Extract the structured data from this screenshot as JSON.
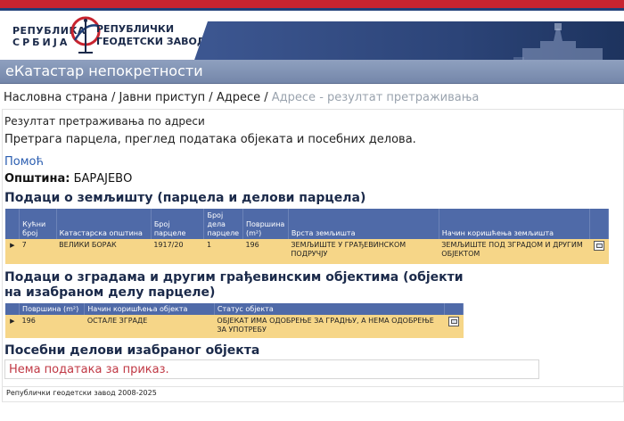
{
  "logo": {
    "left_line1": "РЕПУБЛИКА",
    "left_line2": "СРБИЈА",
    "right_line1": "РЕПУБЛИЧКИ",
    "right_line2": "ГЕОДЕТСКИ ЗАВОД"
  },
  "app_title": "еКатастар непокретности",
  "breadcrumb": {
    "items": [
      "Насловна страна",
      "Јавни приступ",
      "Адресе"
    ],
    "separator": "/",
    "current": "Адресе - резултат претраживања"
  },
  "page": {
    "result_title": "Резултат претраживања по адреси",
    "description": "Претрага парцела, преглед података објеката и посебних делова.",
    "help_link": "Помоћ",
    "municipality_label": "Општина:",
    "municipality_value": "БАРАЈЕВО"
  },
  "land": {
    "heading": "Подаци о земљишту (парцела и делови парцела)",
    "columns": [
      "Кућни број",
      "Катастарска општина",
      "Број парцеле",
      "Број дела парцеле",
      "Површина (m²)",
      "Врста земљишта",
      "Начин коришћења земљишта"
    ],
    "rows": [
      [
        "7",
        "ВЕЛИКИ БОРАК",
        "1917/20",
        "1",
        "196",
        "ЗЕМЉИШТЕ У ГРАЂЕВИНСКОМ ПОДРУЧЈУ",
        "ЗЕМЉИШТЕ ПОД ЗГРАДОМ И ДРУГИМ ОБЈЕКТОМ"
      ]
    ]
  },
  "buildings": {
    "heading_line1": "Подаци о зградама и другим грађевинским објектима (објекти",
    "heading_line2": "на изабраном делу парцеле)",
    "columns": [
      "Површина (m²)",
      "Начин коришћења објекта",
      "Статус објекта"
    ],
    "rows": [
      [
        "196",
        "ОСТАЛЕ ЗГРАДЕ",
        "ОБЈЕКАТ ИМА ОДОБРЕЊЕ ЗА ГРАДЊУ, А НЕМА ОДОБРЕЊЕ ЗА УПОТРЕБУ"
      ]
    ]
  },
  "special_parts": {
    "heading": "Посебни делови изабраног објекта",
    "no_data": "Нема података за приказ."
  },
  "footer": "Републички геодетски завод 2008-2025",
  "colors": {
    "header_band": "#2c4478",
    "title_bar": "#7487aa",
    "table_header": "#4f6aa8",
    "table_row": "#f6d688",
    "no_data_text": "#c03844",
    "link": "#2a5db0"
  },
  "icons": {
    "row_expand": "triangle-right-icon",
    "row_details": "details-window-icon"
  }
}
